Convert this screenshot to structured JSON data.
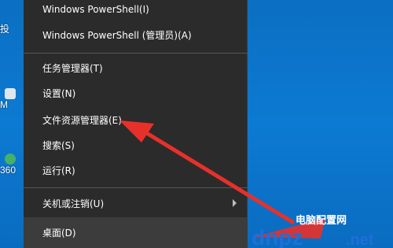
{
  "desktop": {
    "icons": [
      {
        "label": "投"
      },
      {
        "label": "M"
      },
      {
        "label": "360"
      }
    ]
  },
  "menu": {
    "items": [
      {
        "label": "Windows PowerShell(I)"
      },
      {
        "label": "Windows PowerShell (管理员)(A)"
      },
      {
        "label": "任务管理器(T)"
      },
      {
        "label": "设置(N)"
      },
      {
        "label": "文件资源管理器(E)"
      },
      {
        "label": "搜索(S)"
      },
      {
        "label": "运行(R)"
      },
      {
        "label": "关机或注销(U)"
      },
      {
        "label": "桌面(D)"
      }
    ]
  },
  "watermark": {
    "site_name": "电脑配置网",
    "brand": "dnpz",
    "domain": ".net"
  },
  "colors": {
    "desktop_bg": "#0a74c9",
    "menu_bg": "#2b2b2b",
    "menu_text": "#ffffff",
    "arrow": "#e8302a",
    "watermark_blue": "#1e6fd8",
    "watermark_red": "#e8302a"
  }
}
